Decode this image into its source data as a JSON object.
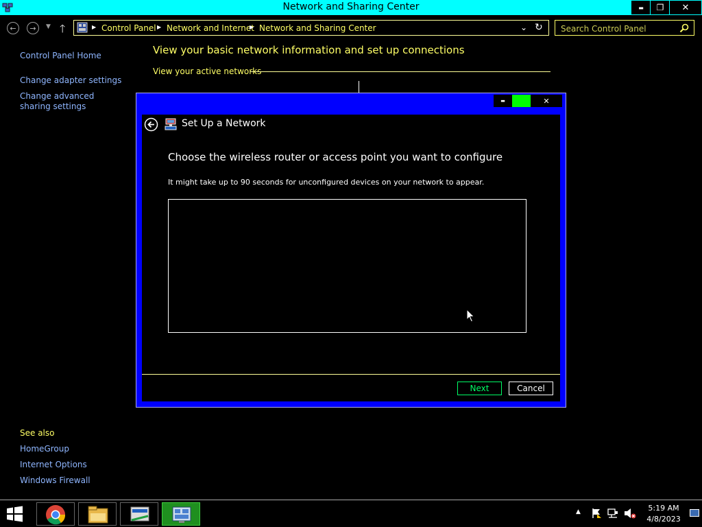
{
  "window": {
    "title": "Network and Sharing Center",
    "buttons": {
      "minimize": "▬",
      "restore": "❐",
      "close": "✕"
    }
  },
  "address_bar": {
    "breadcrumbs": [
      "Control Panel",
      "Network and Internet",
      "Network and Sharing Center"
    ],
    "search_placeholder": "Search Control Panel"
  },
  "sidebar": {
    "home": "Control Panel Home",
    "links": [
      "Change adapter settings",
      "Change advanced sharing settings"
    ],
    "see_also_label": "See also",
    "see_also": [
      "HomeGroup",
      "Internet Options",
      "Windows Firewall"
    ]
  },
  "main": {
    "title": "View your basic network information and set up connections",
    "active_networks_label": "View your active networks"
  },
  "dialog": {
    "title": "Set Up a Network",
    "heading": "Choose the wireless router or access point you want to configure",
    "subtext": "It might take up to 90 seconds for unconfigured devices on your network to appear.",
    "next_label": "Next",
    "cancel_label": "Cancel",
    "title_bar_color": "#0000ff"
  },
  "taskbar": {
    "time": "5:19 AM",
    "date": "4/8/2023",
    "items": [
      "windows-start-icon",
      "chrome-icon",
      "file-explorer-icon",
      "network-settings-icon",
      "control-panel-icon"
    ]
  },
  "colors": {
    "title_bar": "#00ffff",
    "text_yellow": "#ffff66",
    "link_blue": "#8fb6ff",
    "dialog_frame": "#0000ff",
    "next_button": "#00ff66"
  }
}
